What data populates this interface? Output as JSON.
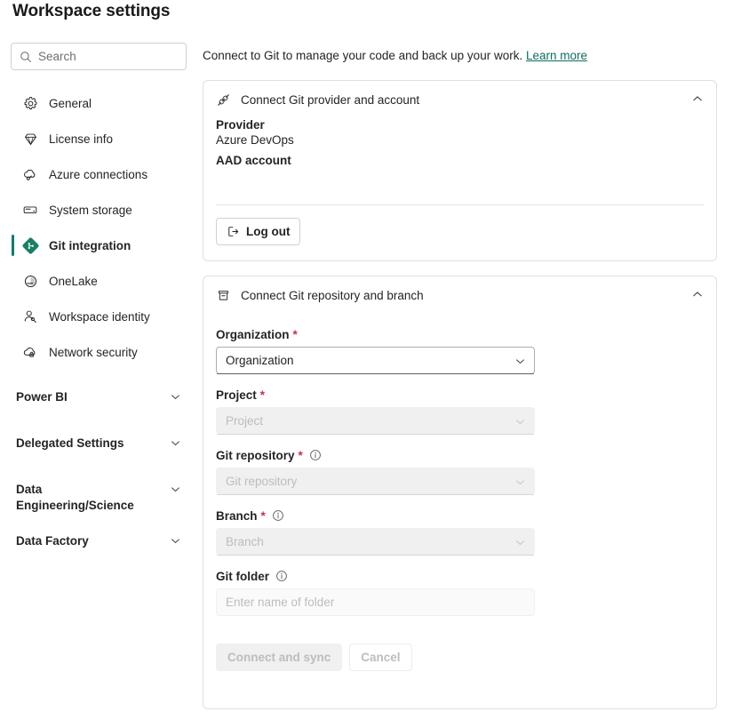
{
  "page": {
    "title": "Workspace settings"
  },
  "search": {
    "placeholder": "Search",
    "value": "",
    "icon": "search-icon"
  },
  "sidebar": {
    "items": [
      {
        "label": "General",
        "icon": "gear-icon",
        "active": false
      },
      {
        "label": "License info",
        "icon": "diamond-gem-icon",
        "active": false
      },
      {
        "label": "Azure connections",
        "icon": "cloud-link-icon",
        "active": false
      },
      {
        "label": "System storage",
        "icon": "storage-drive-icon",
        "active": false
      },
      {
        "label": "Git integration",
        "icon": "git-diamond-icon",
        "active": true
      },
      {
        "label": "OneLake",
        "icon": "onelake-circle-icon",
        "active": false
      },
      {
        "label": "Workspace identity",
        "icon": "person-key-icon",
        "active": false
      },
      {
        "label": "Network security",
        "icon": "cloud-lock-icon",
        "active": false
      }
    ],
    "groups": [
      {
        "label": "Power BI",
        "icon": "chevron-down-icon"
      },
      {
        "label": "Delegated Settings",
        "icon": "chevron-down-icon"
      },
      {
        "label": "Data Engineering/Science",
        "icon": "chevron-down-icon"
      },
      {
        "label": "Data Factory",
        "icon": "chevron-down-icon"
      }
    ]
  },
  "main": {
    "intro_text": "Connect to Git to manage your code and back up your work.",
    "intro_link": "Learn more",
    "provider_card": {
      "icon": "plug-connector-icon",
      "title": "Connect Git provider and account",
      "collapse_icon": "chevron-up-icon",
      "provider_label": "Provider",
      "provider_value": "Azure DevOps",
      "account_label": "AAD account",
      "account_value": "",
      "logout_label": "Log out",
      "logout_icon": "sign-out-icon"
    },
    "repo_card": {
      "icon": "repository-box-icon",
      "title": "Connect Git repository and branch",
      "collapse_icon": "chevron-up-icon",
      "fields": [
        {
          "label": "Organization",
          "required": "*",
          "has_info": false,
          "value": "Organization",
          "placeholder": "Organization",
          "type": "select",
          "disabled": false,
          "chevron": "chevron-down-icon"
        },
        {
          "label": "Project",
          "required": "*",
          "has_info": false,
          "value": "Project",
          "placeholder": "Project",
          "type": "select",
          "disabled": true,
          "chevron": "chevron-down-icon"
        },
        {
          "label": "Git repository",
          "required": "*",
          "has_info": true,
          "info_icon": "info-circle-icon",
          "value": "Git repository",
          "placeholder": "Git repository",
          "type": "select",
          "disabled": true,
          "chevron": "chevron-down-icon"
        },
        {
          "label": "Branch",
          "required": "*",
          "has_info": true,
          "info_icon": "info-circle-icon",
          "value": "Branch",
          "placeholder": "Branch",
          "type": "select",
          "disabled": true,
          "chevron": "chevron-down-icon"
        },
        {
          "label": "Git folder",
          "required": "",
          "has_info": true,
          "info_icon": "info-circle-icon",
          "value": "",
          "placeholder": "Enter name of folder",
          "type": "text",
          "disabled": false
        }
      ],
      "submit_label": "Connect and sync",
      "cancel_label": "Cancel"
    }
  },
  "colors": {
    "accent_teal": "#0f7b6c",
    "link": "#0f6c5e",
    "required_red": "#c4314b",
    "text": "#242424",
    "border": "#e0e0e0",
    "disabled_bg": "#f0f0f0",
    "disabled_text": "#bdbdbd"
  }
}
